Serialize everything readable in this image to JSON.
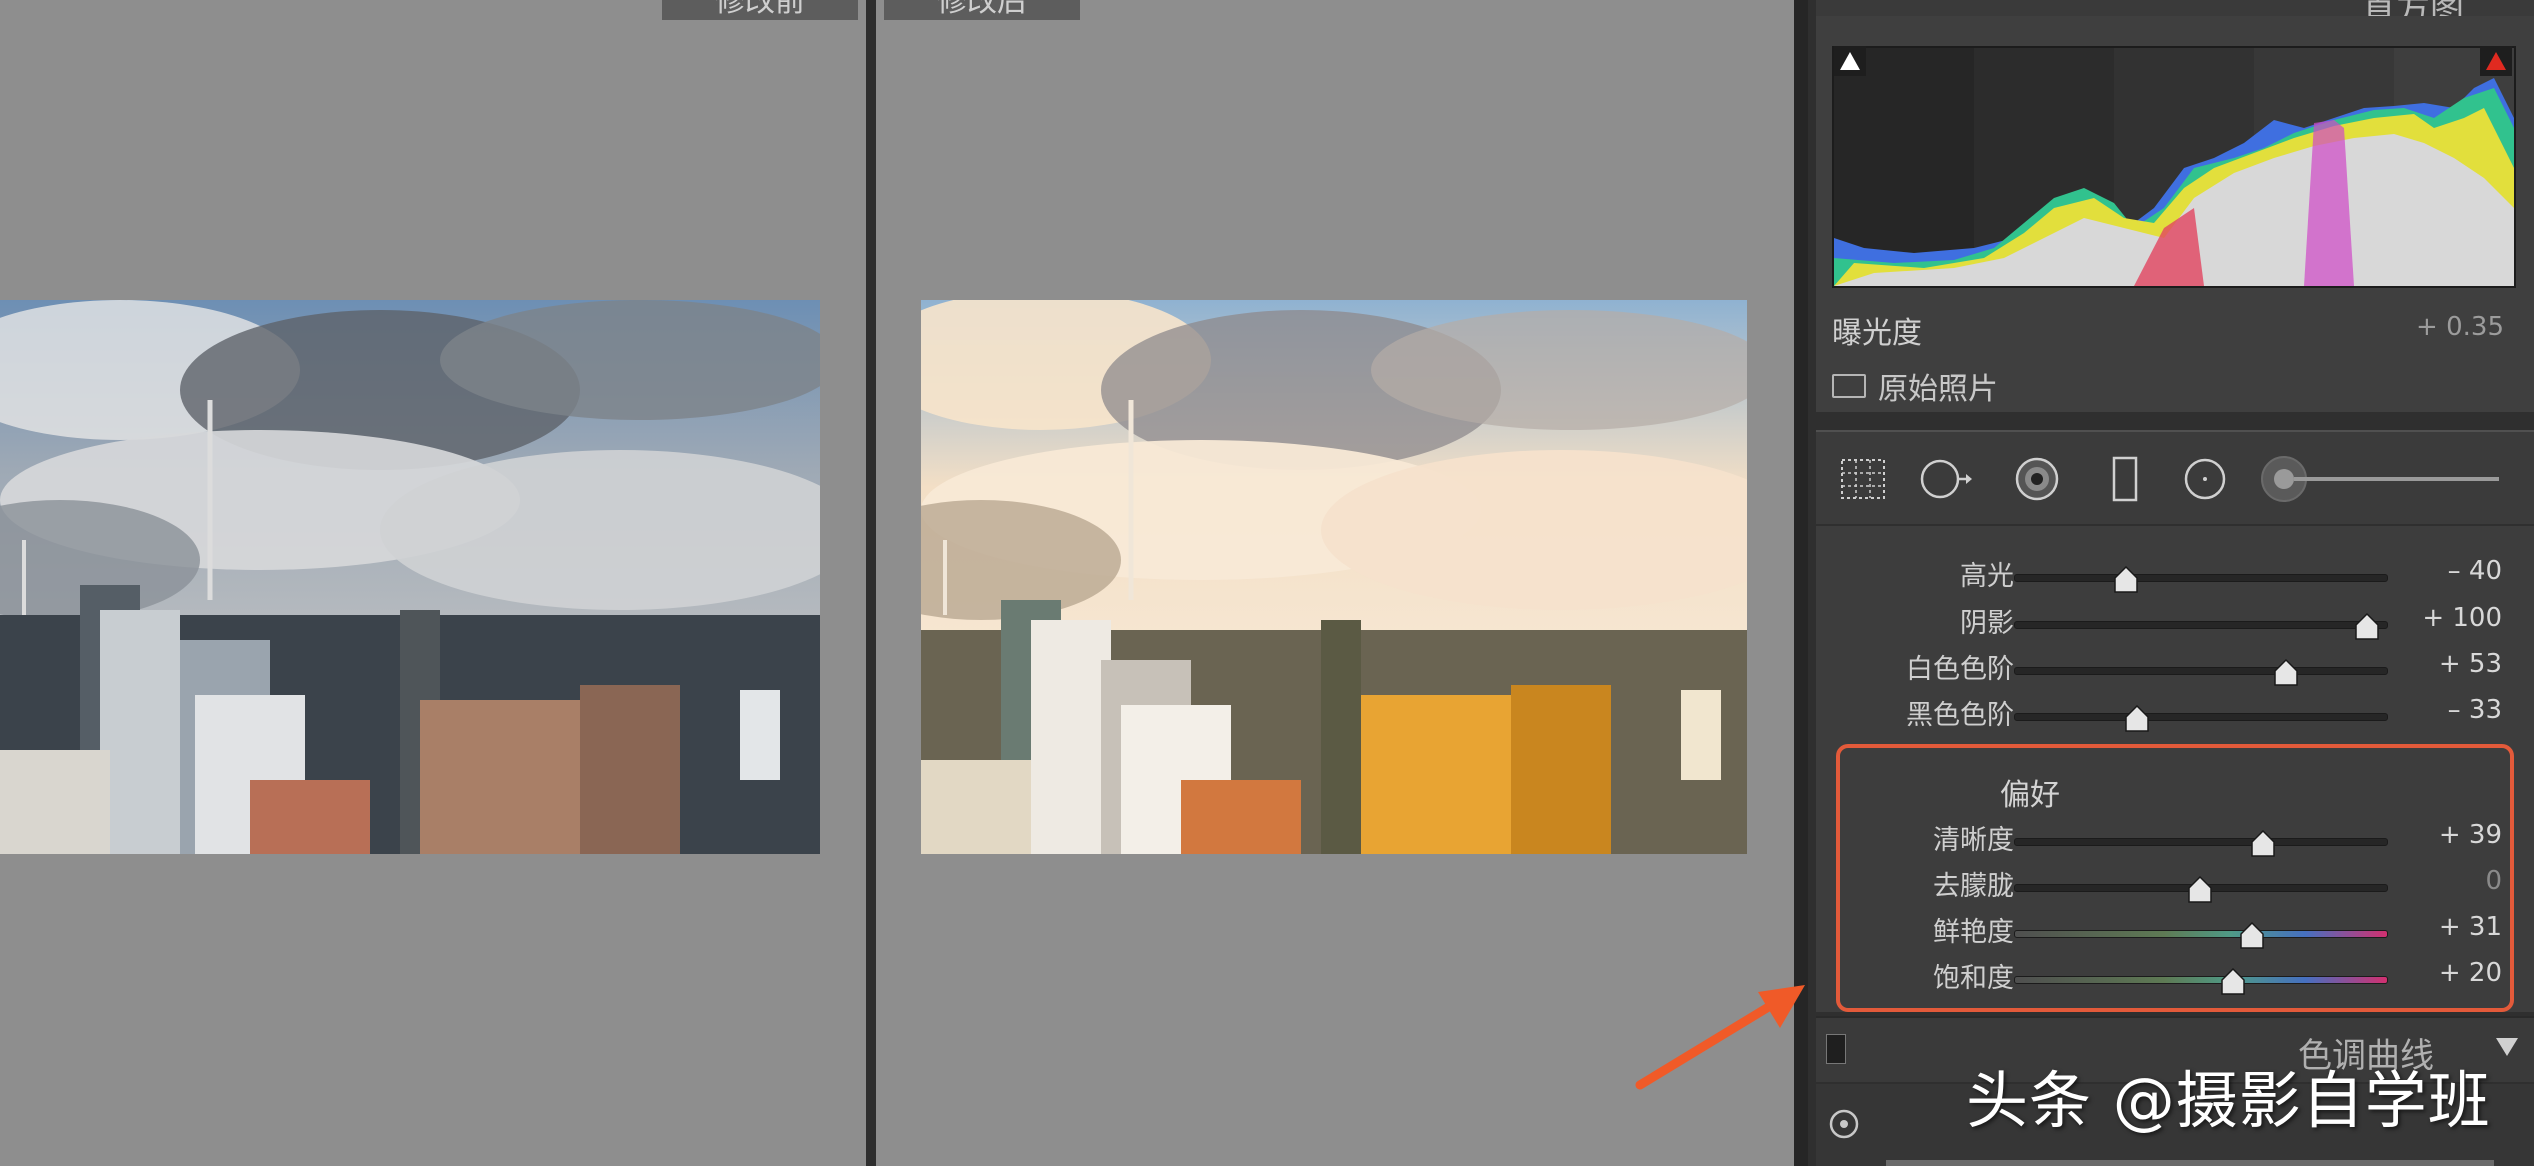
{
  "compare": {
    "before_label": "修改前",
    "after_label": "修改后"
  },
  "histogram": {
    "title": "直方图",
    "exposure_label": "曝光度",
    "exposure_value": "+ 0.35",
    "original_photo_label": "原始照片"
  },
  "tools": [
    "crop-overlay",
    "spot-removal",
    "red-eye",
    "graduated-filter",
    "radial-filter",
    "adjustment-brush"
  ],
  "basic": [
    {
      "label": "高光",
      "value": "– 40",
      "pos": 0.3
    },
    {
      "label": "阴影",
      "value": "+ 100",
      "pos": 0.95
    },
    {
      "label": "白色色阶",
      "value": "+ 53",
      "pos": 0.73
    },
    {
      "label": "黑色色阶",
      "value": "– 33",
      "pos": 0.33
    }
  ],
  "presence": {
    "title": "偏好",
    "items": [
      {
        "label": "清晰度",
        "value": "+ 39",
        "pos": 0.67,
        "hue": false
      },
      {
        "label": "去朦胧",
        "value": "0",
        "pos": 0.5,
        "hue": false
      },
      {
        "label": "鲜艳度",
        "value": "+ 31",
        "pos": 0.64,
        "hue": true
      },
      {
        "label": "饱和度",
        "value": "+ 20",
        "pos": 0.59,
        "hue": true
      }
    ]
  },
  "tone_curve": {
    "title": "色调曲线"
  },
  "colors": {
    "accent": "#e35a3a",
    "panel": "#3d3d3d"
  },
  "watermark": "头条 @摄影自学班"
}
